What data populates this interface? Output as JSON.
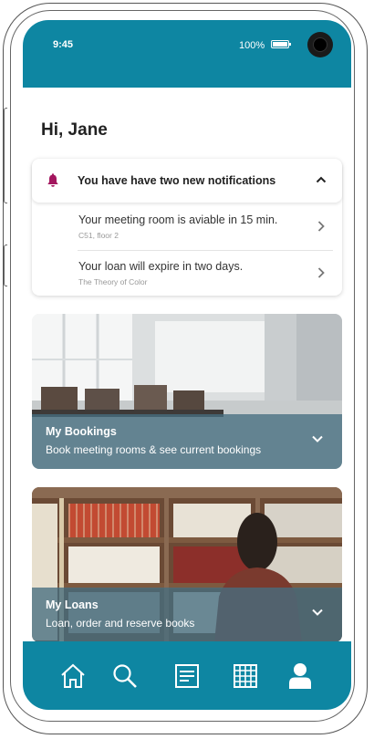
{
  "status_bar": {
    "time": "9:45",
    "battery": "100%"
  },
  "greeting": "Hi, Jane",
  "notifications": {
    "title": "You have have two new notifications",
    "items": [
      {
        "text": "Your meeting room is aviable in 15 min.",
        "subtext": "C51, floor 2"
      },
      {
        "text": "Your loan will expire in two days.",
        "subtext": "The Theory of Color"
      }
    ]
  },
  "cards": {
    "bookings": {
      "title": "My Bookings",
      "subtitle": "Book meeting rooms & see current bookings"
    },
    "loans": {
      "title": "My Loans",
      "subtitle": "Loan, order and reserve books"
    }
  },
  "bottom_nav": [
    "home-icon",
    "search-icon",
    "document-icon",
    "grid-icon",
    "profile-icon"
  ],
  "colors": {
    "primary": "#0e86a2",
    "bell": "#a3165e",
    "overlay": "#466e80"
  }
}
